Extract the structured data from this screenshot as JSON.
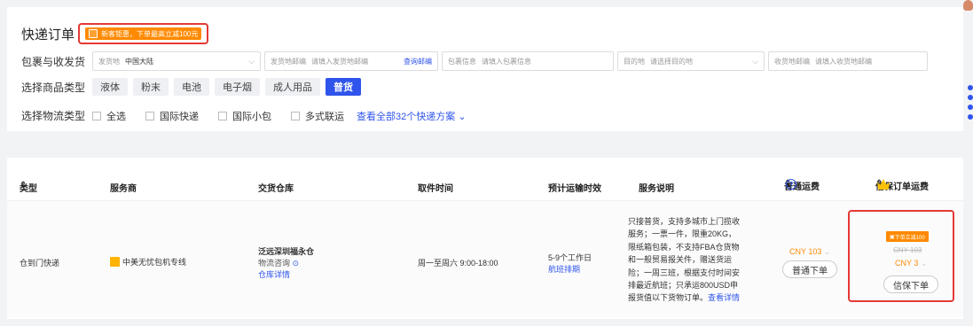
{
  "header": {
    "title": "快递订单",
    "promo_text": "新客钜惠，下单最高立减100元"
  },
  "filters": {
    "package_label": "包裹与收发货",
    "origin": {
      "key": "发货地",
      "value": "中国大陆"
    },
    "origin_zip": {
      "key": "发货地邮编",
      "placeholder": "请填入发货地邮编",
      "link": "查询邮编"
    },
    "package_info": {
      "key": "包裹信息",
      "placeholder": "请填入包裹信息"
    },
    "destination": {
      "key": "目的地",
      "placeholder": "请选择目的地"
    },
    "dest_zip": {
      "key": "收货地邮编",
      "placeholder": "请填入收货地邮编"
    },
    "goods_label": "选择商品类型",
    "goods_types": [
      "液体",
      "粉末",
      "电池",
      "电子烟",
      "成人用品",
      "普货"
    ],
    "logistics_label": "选择物流类型",
    "logistics_types": [
      "全选",
      "国际快递",
      "国际小包",
      "多式联运"
    ],
    "more_link": "查看全部32个快递方案"
  },
  "table": {
    "headers": {
      "type": "类型",
      "carrier": "服务商",
      "warehouse": "交货仓库",
      "pickup": "取件时间",
      "eta": "预计运输时效",
      "desc": "服务说明",
      "normal_fee": "普通运费",
      "insured_fee": "信保订单运费"
    },
    "row": {
      "type": "仓到门快递",
      "carrier": "中美无忧包机专线",
      "warehouse": "泛远深圳福永仓",
      "logistics_consult": "物流咨询",
      "warehouse_detail": "仓库详情",
      "pickup": "周一至周六 9:00-18:00",
      "eta": "5-9个工作日",
      "schedule": "航班排期",
      "desc_lines": [
        "只接普货，支持多城市上门揽收",
        "服务；一票一件，限重20KG，",
        "限纸箱包装，不支持FBA仓货物",
        "和一般贸易报关件，赠送货运",
        "险；一周三班，根据支付时间安",
        "排最近航班；只承运800USD申"
      ],
      "desc_last": "报货值以下货物订单。",
      "desc_more": "查看详情",
      "normal_price": "CNY 103",
      "normal_btn": "普通下单",
      "discount_tag": "下单立减100",
      "orig_price": "CNY 103",
      "insured_price": "CNY 3",
      "insured_btn": "信保下单"
    }
  },
  "colors": {
    "accent": "#2f54eb",
    "promo": "#ff8a00",
    "highlight": "#e53935"
  }
}
